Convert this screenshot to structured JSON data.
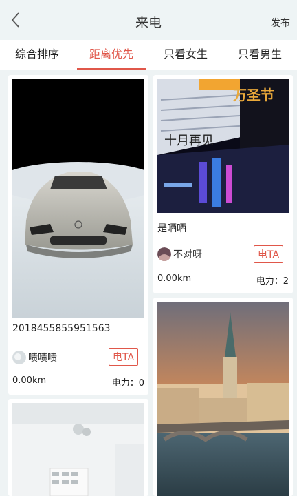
{
  "header": {
    "title": "来电",
    "publish_label": "发布"
  },
  "tabs": [
    {
      "label": "综合排序"
    },
    {
      "label": "距离优先"
    },
    {
      "label": "只看女生"
    },
    {
      "label": "只看男生"
    }
  ],
  "active_tab_index": 1,
  "accent_color": "#e0574a",
  "cards": [
    {
      "title": "2018455855951563",
      "author": "啧啧啧",
      "call_label": "电TA",
      "distance": "0.00km",
      "power": "电力：0"
    },
    {
      "title": "是晒晒",
      "author": "不对呀",
      "call_label": "电TA",
      "distance": "0.00km",
      "power": "电力：2"
    }
  ],
  "photo_texts": {
    "halloween": "万圣节",
    "october": "十月再见"
  }
}
